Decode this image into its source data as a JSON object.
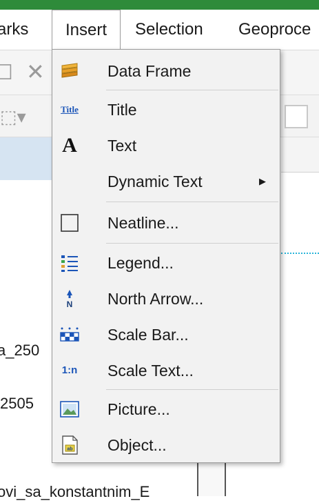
{
  "menubar": {
    "bookmarks_partial": "arks",
    "insert": "Insert",
    "selection": "Selection",
    "geoprocessing_partial": "Geoproce"
  },
  "background": {
    "row1_text": "a_250",
    "row2_text": "2505",
    "row3_text": "ovi_sa_konstantnim_E"
  },
  "insert_menu": {
    "items": [
      {
        "label": "Data Frame",
        "icon": "data-frame-icon"
      },
      {
        "label": "Title",
        "icon": "title-icon",
        "glyph": "Title"
      },
      {
        "label": "Text",
        "icon": "text-icon",
        "glyph": "A"
      },
      {
        "label": "Dynamic Text",
        "icon": "",
        "submenu": true
      },
      {
        "label": "Neatline...",
        "icon": "neatline-icon"
      },
      {
        "label": "Legend...",
        "icon": "legend-icon"
      },
      {
        "label": "North Arrow...",
        "icon": "north-arrow-icon"
      },
      {
        "label": "Scale Bar...",
        "icon": "scale-bar-icon"
      },
      {
        "label": "Scale Text...",
        "icon": "scale-text-icon",
        "glyph": "1:n"
      },
      {
        "label": "Picture...",
        "icon": "picture-icon"
      },
      {
        "label": "Object...",
        "icon": "object-icon"
      }
    ]
  },
  "colors": {
    "title_bar_green": "#2e8b3a",
    "menu_background": "#f2f2f2",
    "icon_blue": "#1b55b8",
    "guide_dotted": "#27b3d9"
  }
}
